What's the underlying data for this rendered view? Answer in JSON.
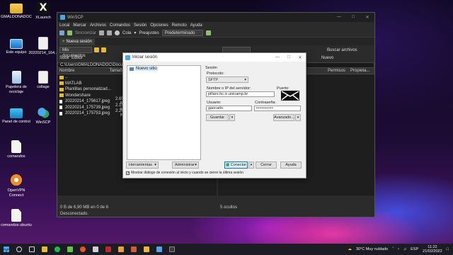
{
  "colors": {
    "window_bg": "#2b2b2b",
    "dialog_bg": "#f0f0f0",
    "accent_blue": "#0078d7",
    "taskbar_bg": "#1c1c24"
  },
  "desktop": {
    "icons": [
      {
        "label": "GMALDONADOC",
        "icon": "folder-user-icon"
      },
      {
        "label": "XLaunch",
        "icon": "xlaunch-icon"
      },
      {
        "label": "Este equipo",
        "icon": "computer-icon"
      },
      {
        "label": "20220214_164...",
        "icon": "image-file-icon"
      },
      {
        "label": "Papelera de reciclaje",
        "icon": "recycle-bin-icon"
      },
      {
        "label": "collage",
        "icon": "image-file-icon"
      },
      {
        "label": "Panel de control",
        "icon": "control-panel-icon"
      },
      {
        "label": "WinSCP",
        "icon": "winscp-icon"
      },
      {
        "label": "comandos",
        "icon": "document-icon"
      },
      {
        "label": "OpenVPN Connect",
        "icon": "openvpn-icon"
      },
      {
        "label": "comandos ubuntu",
        "icon": "document-icon"
      }
    ]
  },
  "winscp": {
    "title": "WinSCP",
    "menu": [
      "Local",
      "Marcar",
      "Archivos",
      "Comandos",
      "Sesión",
      "Opciones",
      "Remoto",
      "Ayuda"
    ],
    "toolbar": {
      "sync_label": "Sincronizar",
      "queue_label": "Cola",
      "presets_label": "Preajustes",
      "presets_value": "Predeterminado"
    },
    "tab_label": "Nueva sesión",
    "left": {
      "location": "Mis documentos",
      "upload_label": "Subir",
      "edit_label": "Editor",
      "path": "C:\\Users\\GMALDONADOC\\Documents\\",
      "columns": [
        "Nombre",
        "Tamaño"
      ],
      "rows": [
        {
          "name": "..",
          "size": "",
          "type": "up"
        },
        {
          "name": "MATLAB",
          "size": "",
          "type": "folder"
        },
        {
          "name": "Plantillas personalizad...",
          "size": "",
          "type": "folder"
        },
        {
          "name": "Wondershare",
          "size": "",
          "type": "folder"
        },
        {
          "name": "20220214_175617.jpeg",
          "size": "2.655 KB",
          "type": "file"
        },
        {
          "name": "20220214_175739.jpeg",
          "size": "2.154 KB",
          "type": "file"
        },
        {
          "name": "20220214_175753.jpeg",
          "size": "2.261 KB",
          "type": "file"
        }
      ],
      "status": "0 B de 6,90 MB en 0 de 6"
    },
    "right": {
      "search_label": "Buscar archivos",
      "new_label": "Nuevo",
      "columns": [
        "Permisos",
        "Propieta..."
      ]
    },
    "hidden_label": "5 ocultos",
    "connection_status": "Desconectado."
  },
  "login_dialog": {
    "title": "Iniciar sesión",
    "site_item": "Nuevo sitio",
    "section_label": "Sesión",
    "protocol_label": "Protocolo:",
    "protocol_value": "SFTP",
    "host_label": "Nombre o IP del servidor:",
    "host_value": "pillaro.hc.ic.unicamp.br",
    "port_label": "Puerto:",
    "user_label": "Usuario:",
    "user_value": "gaocarlo",
    "password_label": "Contraseña:",
    "password_value": "••••••••••",
    "save_label": "Guardar",
    "advanced_label": "Avanzado...",
    "tools_label": "Herramientas",
    "manage_label": "Administrar",
    "login_label": "Conectar",
    "close_label": "Cerrar",
    "help_label": "Ayuda",
    "show_on_start": "Mostrar diálogo de conexión al inicio y cuando se cierre la última sesión"
  },
  "taskbar": {
    "weather": "30°C  Muy nublado",
    "lang": "ESP",
    "time": "11:22",
    "date": "21/02/2022"
  }
}
